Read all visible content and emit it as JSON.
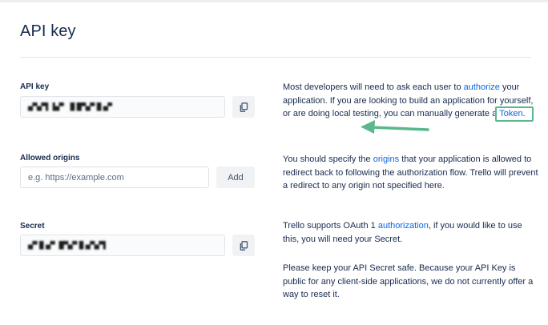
{
  "page": {
    "title": "API key"
  },
  "api_key": {
    "label": "API key",
    "value_masked": "▄▀▄▀▌▐▄▀ ▐▌█▀▄▀▐▌▄▀",
    "copy_icon": "copy-icon"
  },
  "allowed_origins": {
    "label": "Allowed origins",
    "placeholder": "e.g. https://example.com",
    "add_label": "Add"
  },
  "secret": {
    "label": "Secret",
    "value_masked": "▄▀▐▌▄▀ █▀▄▀▐▌▄▀▄▀▌",
    "copy_icon": "copy-icon"
  },
  "descriptions": {
    "api_key_p1": "Most developers will need to ask each user to ",
    "api_key_link": "authorize",
    "api_key_p2": " your application. If you are looking to build an application for yourself, or are doing local testing, you can manually generate a ",
    "token_link": "Token",
    "api_key_p3": ".",
    "origins_p1": "You should specify the ",
    "origins_link": "origins",
    "origins_p2": " that your application is allowed to redirect back to following the authorization flow. Trello will prevent a redirect to any origin not specified here.",
    "secret_p1": "Trello supports OAuth 1 ",
    "secret_link": "authorization",
    "secret_p2": ", if you would like to use this, you will need your Secret.",
    "secret_safe": "Please keep your API Secret safe. Because your API Key is public for any client-side applications, we do not currently offer a way to reset it."
  },
  "colors": {
    "link": "#0c66e4",
    "highlight": "#5bb78d",
    "text": "#172b4d"
  }
}
